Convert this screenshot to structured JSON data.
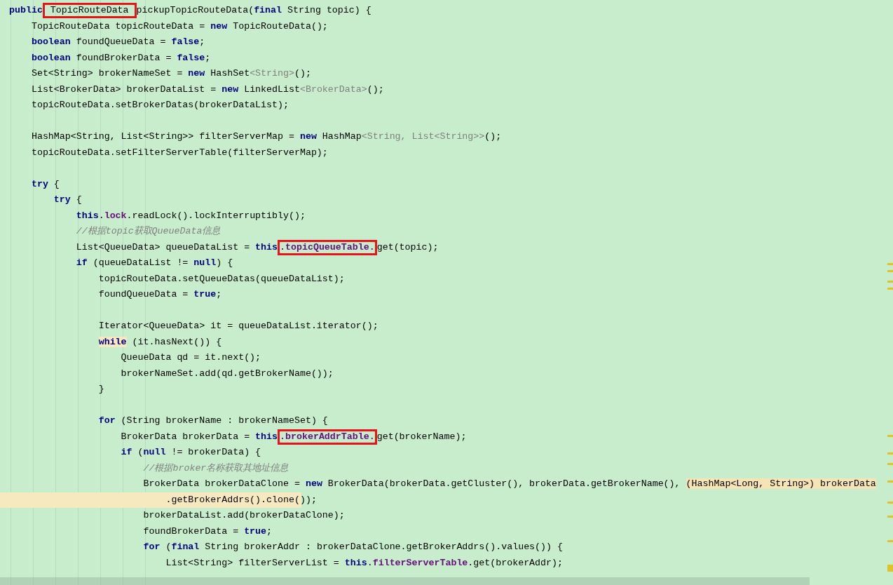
{
  "editor": {
    "lines": [
      {
        "kind": "code",
        "tokens": [
          {
            "text": "public",
            "kind": "kw"
          },
          {
            "text": " TopicRouteData ",
            "kind": "boxed"
          },
          {
            "text": "pickupTopicRouteData(",
            "kind": "plain"
          },
          {
            "text": "final",
            "kind": "kw"
          },
          {
            "text": " String topic) {",
            "kind": "plain"
          }
        ]
      },
      {
        "kind": "code",
        "tokens": [
          {
            "text": "    TopicRouteData topicRouteData = ",
            "kind": "plain"
          },
          {
            "text": "new",
            "kind": "kw"
          },
          {
            "text": " TopicRouteData();",
            "kind": "plain"
          }
        ]
      },
      {
        "kind": "code",
        "tokens": [
          {
            "text": "    boolean",
            "kind": "kw"
          },
          {
            "text": " foundQueueData = ",
            "kind": "plain"
          },
          {
            "text": "false",
            "kind": "kw"
          },
          {
            "text": ";",
            "kind": "plain"
          }
        ]
      },
      {
        "kind": "code",
        "tokens": [
          {
            "text": "    boolean",
            "kind": "kw"
          },
          {
            "text": " foundBrokerData = ",
            "kind": "plain"
          },
          {
            "text": "false",
            "kind": "kw"
          },
          {
            "text": ";",
            "kind": "plain"
          }
        ]
      },
      {
        "kind": "code",
        "tokens": [
          {
            "text": "    Set<String> brokerNameSet = ",
            "kind": "plain"
          },
          {
            "text": "new",
            "kind": "kw"
          },
          {
            "text": " HashSet",
            "kind": "plain"
          },
          {
            "text": "<String>",
            "kind": "gen"
          },
          {
            "text": "();",
            "kind": "plain"
          }
        ]
      },
      {
        "kind": "code",
        "tokens": [
          {
            "text": "    List<BrokerData> brokerDataList = ",
            "kind": "plain"
          },
          {
            "text": "new",
            "kind": "kw"
          },
          {
            "text": " LinkedList",
            "kind": "plain"
          },
          {
            "text": "<BrokerData>",
            "kind": "gen"
          },
          {
            "text": "();",
            "kind": "plain"
          }
        ]
      },
      {
        "kind": "code",
        "tokens": [
          {
            "text": "    topicRouteData.setBrokerDatas(brokerDataList);",
            "kind": "plain"
          }
        ]
      },
      {
        "kind": "blank"
      },
      {
        "kind": "code",
        "tokens": [
          {
            "text": "    HashMap<String, List<String>> filterServerMap = ",
            "kind": "plain"
          },
          {
            "text": "new",
            "kind": "kw"
          },
          {
            "text": " HashMap",
            "kind": "plain"
          },
          {
            "text": "<String, List<String>>",
            "kind": "gen"
          },
          {
            "text": "();",
            "kind": "plain"
          }
        ]
      },
      {
        "kind": "code",
        "tokens": [
          {
            "text": "    topicRouteData.setFilterServerTable(filterServerMap);",
            "kind": "plain"
          }
        ]
      },
      {
        "kind": "blank"
      },
      {
        "kind": "code",
        "tokens": [
          {
            "text": "    try",
            "kind": "kw"
          },
          {
            "text": " {",
            "kind": "plain"
          }
        ]
      },
      {
        "kind": "code",
        "tokens": [
          {
            "text": "        try",
            "kind": "kw"
          },
          {
            "text": " {",
            "kind": "plain"
          }
        ]
      },
      {
        "kind": "code",
        "tokens": [
          {
            "text": "            this",
            "kind": "kw"
          },
          {
            "text": ".",
            "kind": "plain"
          },
          {
            "text": "lock",
            "kind": "field"
          },
          {
            "text": ".readLock().lockInterruptibly();",
            "kind": "plain"
          }
        ]
      },
      {
        "kind": "code",
        "tokens": [
          {
            "text": "            //根据topic获取QueueData信息",
            "kind": "comment"
          }
        ]
      },
      {
        "kind": "code",
        "tokens": [
          {
            "text": "            List<QueueData> queueDataList = ",
            "kind": "plain"
          },
          {
            "text": "this",
            "kind": "kw"
          },
          {
            "text": ".topicQueueTable.",
            "kind": "boxed-field"
          },
          {
            "text": "get(topic);",
            "kind": "plain"
          }
        ]
      },
      {
        "kind": "code",
        "tokens": [
          {
            "text": "            if",
            "kind": "kw"
          },
          {
            "text": " (queueDataList != ",
            "kind": "plain"
          },
          {
            "text": "null",
            "kind": "kw"
          },
          {
            "text": ") {",
            "kind": "plain"
          }
        ]
      },
      {
        "kind": "code",
        "tokens": [
          {
            "text": "                topicRouteData.setQueueDatas(queueDataList);",
            "kind": "plain"
          }
        ]
      },
      {
        "kind": "code",
        "tokens": [
          {
            "text": "                foundQueueData = ",
            "kind": "plain"
          },
          {
            "text": "true",
            "kind": "kw"
          },
          {
            "text": ";",
            "kind": "plain"
          }
        ]
      },
      {
        "kind": "blank"
      },
      {
        "kind": "code",
        "tokens": [
          {
            "text": "                Iterator<QueueData> it = queueDataList.iterator();",
            "kind": "plain"
          }
        ]
      },
      {
        "kind": "code",
        "tokens": [
          {
            "text": "                while",
            "kind": "kw-marked"
          },
          {
            "text": " (it.hasNext()) {",
            "kind": "plain"
          }
        ]
      },
      {
        "kind": "code",
        "tokens": [
          {
            "text": "                    QueueData qd = it.next();",
            "kind": "plain"
          }
        ]
      },
      {
        "kind": "code",
        "tokens": [
          {
            "text": "                    brokerNameSet.add(qd.getBrokerName());",
            "kind": "plain"
          }
        ]
      },
      {
        "kind": "code",
        "tokens": [
          {
            "text": "                }",
            "kind": "plain"
          }
        ]
      },
      {
        "kind": "blank"
      },
      {
        "kind": "code",
        "tokens": [
          {
            "text": "                for",
            "kind": "kw"
          },
          {
            "text": " (String brokerName : brokerNameSet) {",
            "kind": "plain"
          }
        ]
      },
      {
        "kind": "code",
        "tokens": [
          {
            "text": "                    BrokerData brokerData = ",
            "kind": "plain"
          },
          {
            "text": "this",
            "kind": "kw"
          },
          {
            "text": ".brokerAddrTable.",
            "kind": "boxed-field"
          },
          {
            "text": "get(brokerName);",
            "kind": "plain"
          }
        ]
      },
      {
        "kind": "code",
        "tokens": [
          {
            "text": "                    if",
            "kind": "kw"
          },
          {
            "text": " (",
            "kind": "plain"
          },
          {
            "text": "null",
            "kind": "kw"
          },
          {
            "text": " != brokerData) {",
            "kind": "plain"
          }
        ]
      },
      {
        "kind": "code",
        "tokens": [
          {
            "text": "                        //根据broker名称获取其地址信息",
            "kind": "comment"
          }
        ]
      },
      {
        "kind": "code",
        "tokens": [
          {
            "text": "                        BrokerData brokerDataClone = ",
            "kind": "plain"
          },
          {
            "text": "new",
            "kind": "kw"
          },
          {
            "text": " BrokerData(brokerData.getCluster(), brokerData.getBrokerName(), ",
            "kind": "plain"
          },
          {
            "text": "(HashMap<Long, String>) brokerData",
            "kind": "marked"
          }
        ]
      },
      {
        "kind": "current",
        "tokens": [
          {
            "text": "                            .getBrokerAddrs().clone());",
            "kind": "plain"
          }
        ]
      },
      {
        "kind": "code",
        "tokens": [
          {
            "text": "                        brokerDataList.add(brokerDataClone);",
            "kind": "plain"
          }
        ]
      },
      {
        "kind": "code",
        "tokens": [
          {
            "text": "                        foundBrokerData = ",
            "kind": "plain"
          },
          {
            "text": "true",
            "kind": "kw"
          },
          {
            "text": ";",
            "kind": "plain"
          }
        ]
      },
      {
        "kind": "code",
        "tokens": [
          {
            "text": "                        for",
            "kind": "kw"
          },
          {
            "text": " (",
            "kind": "plain"
          },
          {
            "text": "final",
            "kind": "kw"
          },
          {
            "text": " String brokerAddr : brokerDataClone.getBrokerAddrs().values()) {",
            "kind": "plain"
          }
        ]
      },
      {
        "kind": "code",
        "tokens": [
          {
            "text": "                            List<String> filterServerList = ",
            "kind": "plain"
          },
          {
            "text": "this",
            "kind": "kw"
          },
          {
            "text": ".",
            "kind": "plain"
          },
          {
            "text": "filterServerTable",
            "kind": "field"
          },
          {
            "text": ".get(brokerAddr);",
            "kind": "plain"
          }
        ]
      }
    ]
  }
}
